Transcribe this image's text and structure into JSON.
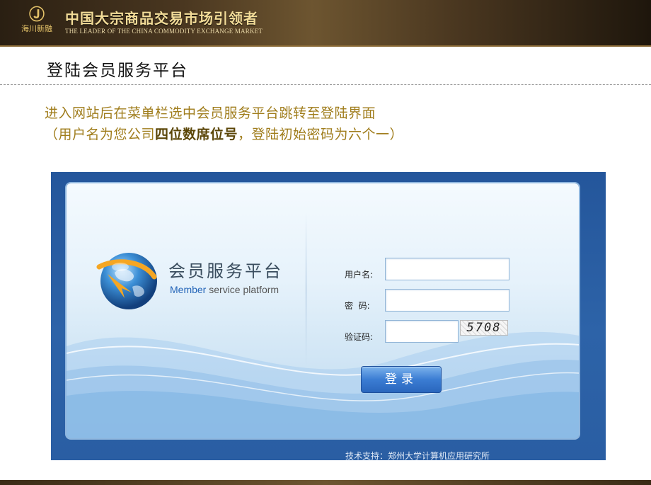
{
  "header": {
    "logo_mark": "Ⓙ",
    "logo_brand": "海川新融",
    "title_cn": "中国大宗商品交易市场引领者",
    "title_en": "THE LEADER OF THE CHINA COMMODITY  EXCHANGE MARKET"
  },
  "slide": {
    "title": "登陆会员服务平台",
    "instruction_line1": "进入网站后在菜单栏选中会员服务平台跳转至登陆界面",
    "instruction_line2_prefix": "（用户名为您公司",
    "instruction_line2_bold": "四位数席位号",
    "instruction_line2_suffix": "，登陆初始密码为六个一）"
  },
  "login": {
    "platform_cn": "会员服务平台",
    "platform_en_member": "Member",
    "platform_en_rest": " service platform",
    "username_label": "用户名:",
    "username_value": "",
    "password_label": "密  码:",
    "password_value": "",
    "captcha_label": "验证码:",
    "captcha_value": "",
    "captcha_text": "5708",
    "submit_label": "登录",
    "support_text": "技术支持：郑州大学计算机应用研究所"
  },
  "colors": {
    "banner_gold": "#f3dc98",
    "instruction_text": "#a07d1c",
    "frame_blue": "#2a5ea3",
    "button_blue": "#3b7dd3"
  }
}
